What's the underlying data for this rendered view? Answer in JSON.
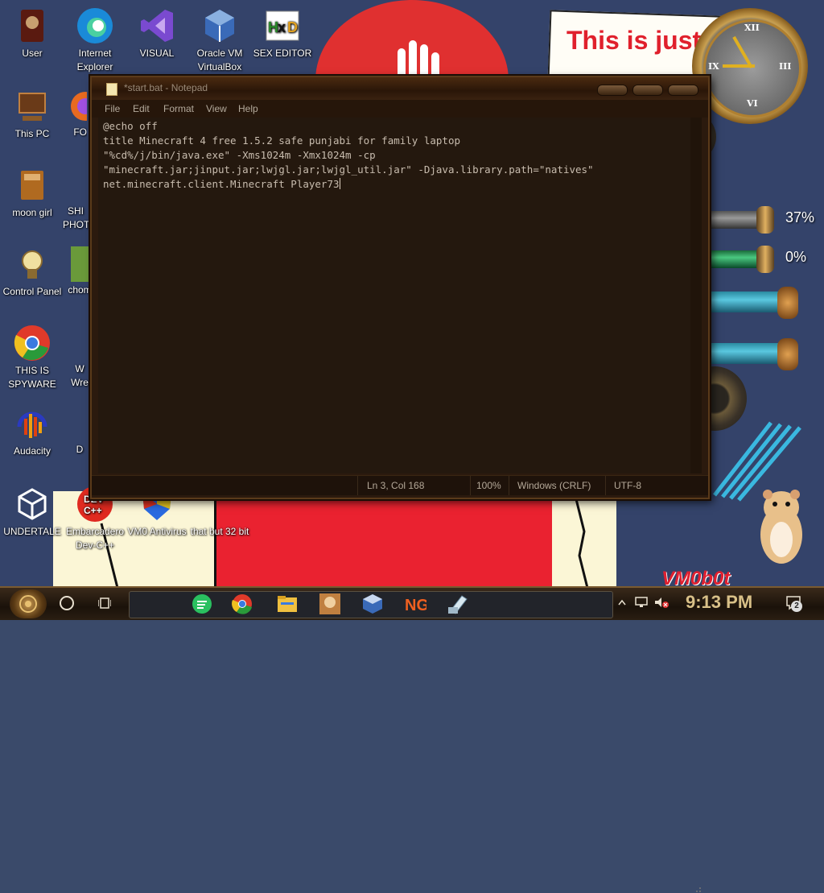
{
  "wallpaper": {
    "sign_text": "This is just George Or",
    "clock_numerals": [
      "XII",
      "III",
      "VI",
      "IX"
    ],
    "logo_text": "VM0b0t"
  },
  "desktop_icons": [
    {
      "label": "User",
      "icon": "user-folder-icon"
    },
    {
      "label": "Internet Explorer",
      "icon": "edge-icon"
    },
    {
      "label": "VISUAL",
      "icon": "visual-studio-icon"
    },
    {
      "label": "Oracle VM VirtualBox",
      "icon": "virtualbox-icon"
    },
    {
      "label": "SEX EDITOR",
      "icon": "hxd-icon"
    },
    {
      "label": "This PC",
      "icon": "computer-icon"
    },
    {
      "label": "FO",
      "icon": "firefox-icon"
    },
    {
      "label": "moon girl",
      "icon": "package-icon"
    },
    {
      "label": "SHI PHOT",
      "icon": "app-icon"
    },
    {
      "label": "Control Panel",
      "icon": "control-panel-icon"
    },
    {
      "label": "chom",
      "icon": "app-icon"
    },
    {
      "label": "THIS IS SPYWARE",
      "icon": "chrome-icon"
    },
    {
      "label": "W Wre",
      "icon": "app-icon"
    },
    {
      "label": "Audacity",
      "icon": "audacity-icon"
    },
    {
      "label": "D",
      "icon": "app-icon"
    },
    {
      "label": "UNDERTALE",
      "icon": "unity-icon"
    },
    {
      "label": "Embarcadero Dev-C++",
      "icon": "devcpp-icon"
    },
    {
      "label": "VM0 Antivirus",
      "icon": "shield-icon"
    },
    {
      "label": "that but 32 bit",
      "icon": "app-icon"
    }
  ],
  "gadgets": {
    "meter1_percent": "37%",
    "meter2_percent": "0%"
  },
  "notepad": {
    "title": "*start.bat - Notepad",
    "menu": [
      "File",
      "Edit",
      "Format",
      "View",
      "Help"
    ],
    "lines": [
      "@echo off",
      "title Minecraft 4 free 1.5.2 safe punjabi for family laptop",
      "\"%cd%/j/bin/java.exe\" -Xms1024m -Xmx1024m -cp",
      "\"minecraft.jar;jinput.jar;lwjgl.jar;lwjgl_util.jar\" -Djava.library.path=\"natives\"",
      "net.minecraft.client.Minecraft Player73"
    ],
    "status": {
      "position": "Ln 3, Col 168",
      "zoom": "100%",
      "line_ending": "Windows (CRLF)",
      "encoding": "UTF-8"
    }
  },
  "taskbar": {
    "apps": [
      "green-chat-icon",
      "chrome-icon",
      "file-explorer-icon",
      "game-icon",
      "virtualbox-icon",
      "newgrounds-icon",
      "notepad-icon"
    ],
    "time": "9:13 PM",
    "notification_count": "2"
  }
}
